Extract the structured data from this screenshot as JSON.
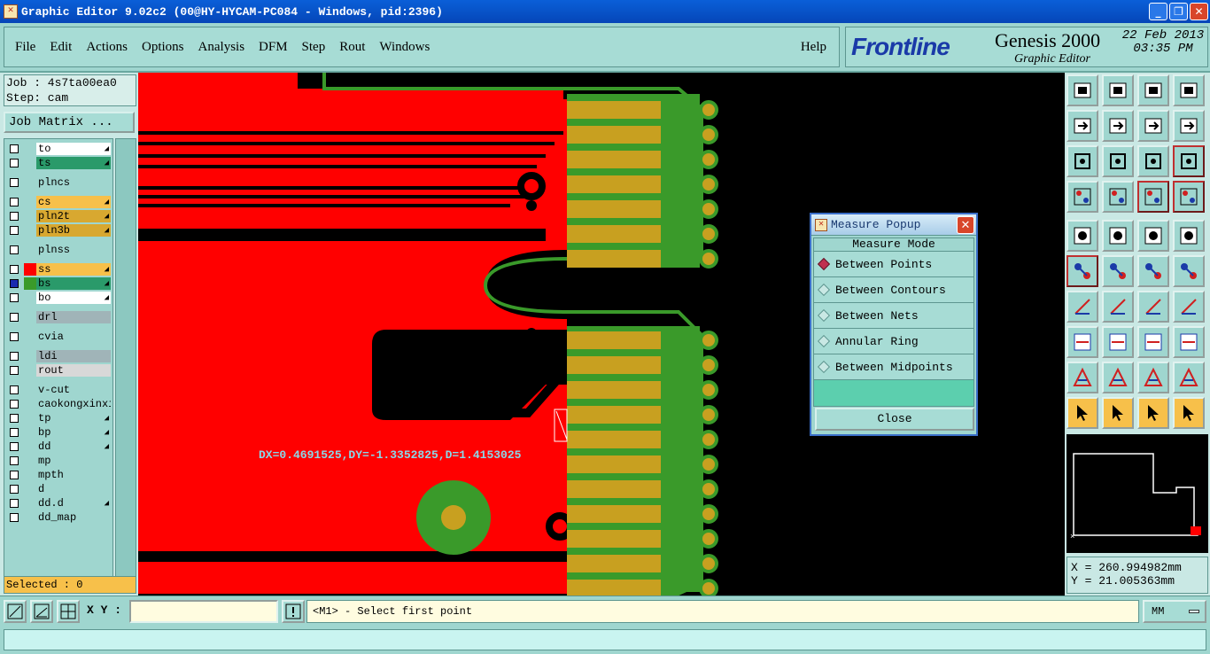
{
  "window": {
    "title": "Graphic Editor 9.02c2 (00@HY-HYCAM-PC084 - Windows, pid:2396)"
  },
  "menu": {
    "items": [
      "File",
      "Edit",
      "Actions",
      "Options",
      "Analysis",
      "DFM",
      "Step",
      "Rout",
      "Windows"
    ],
    "help": "Help"
  },
  "brand": {
    "logo": "Frontline",
    "product": "Genesis 2000",
    "subtitle": "Graphic Editor",
    "date": "22 Feb 2013",
    "time": "03:35 PM"
  },
  "job": {
    "job_line": "Job : 4s7ta00ea0",
    "step_line": "Step: cam",
    "matrix_button": "Job Matrix ..."
  },
  "layers": [
    {
      "name": "to",
      "color": "#ffffff",
      "arrow": true
    },
    {
      "name": "ts",
      "color": "#2a9a6a",
      "arrow": true
    },
    {
      "name": "plncs",
      "color": "#9fd6cf",
      "arrow": false
    },
    {
      "name": "cs",
      "color": "#f7c04a",
      "arrow": true
    },
    {
      "name": "pln2t",
      "color": "#d8a830",
      "arrow": true
    },
    {
      "name": "pln3b",
      "color": "#d8a830",
      "arrow": true
    },
    {
      "name": "plnss",
      "color": "#9fd6cf",
      "arrow": false
    },
    {
      "name": "ss",
      "color": "#f7c04a",
      "arrow": true
    },
    {
      "name": "bs",
      "color": "#2a9a6a",
      "arrow": true
    },
    {
      "name": "bo",
      "color": "#ffffff",
      "arrow": true
    },
    {
      "name": "drl",
      "color": "#a0b4b8",
      "arrow": false
    },
    {
      "name": "cvia",
      "color": "#9fd6cf",
      "arrow": false
    },
    {
      "name": "ldi",
      "color": "#a0b4b8",
      "arrow": false
    },
    {
      "name": "rout",
      "color": "#d8d8d8",
      "arrow": false
    },
    {
      "name": "v-cut",
      "color": "#9fd6cf",
      "arrow": false
    },
    {
      "name": "caokongxinxi",
      "color": "#9fd6cf",
      "arrow": false
    },
    {
      "name": "tp",
      "color": "#9fd6cf",
      "arrow": true
    },
    {
      "name": "bp",
      "color": "#9fd6cf",
      "arrow": true
    },
    {
      "name": "dd",
      "color": "#9fd6cf",
      "arrow": true
    },
    {
      "name": "mp",
      "color": "#9fd6cf",
      "arrow": false
    },
    {
      "name": "mpth",
      "color": "#9fd6cf",
      "arrow": false
    },
    {
      "name": "d",
      "color": "#9fd6cf",
      "arrow": false
    },
    {
      "name": "dd.d",
      "color": "#9fd6cf",
      "arrow": true
    },
    {
      "name": "dd_map",
      "color": "#9fd6cf",
      "arrow": false
    }
  ],
  "selected": "Selected : 0",
  "canvas": {
    "measure_readout": "DX=0.4691525,DY=-1.3352825,D=1.4153025",
    "colors": {
      "copper": "#ff0000",
      "pad": "#c8a020",
      "mask": "#3a9a2a",
      "background": "#000000"
    }
  },
  "measure_popup": {
    "title": "Measure Popup",
    "mode_header": "Measure Mode",
    "options": [
      {
        "label": "Between Points",
        "selected": true
      },
      {
        "label": "Between Contours",
        "selected": false
      },
      {
        "label": "Between Nets",
        "selected": false
      },
      {
        "label": "Annular Ring",
        "selected": false
      },
      {
        "label": "Between Midpoints",
        "selected": false
      }
    ],
    "close_label": "Close"
  },
  "coordinates": {
    "x": "X = 260.994982mm",
    "y": "Y = 21.005363mm"
  },
  "statusbar": {
    "xy_label": "X Y :",
    "xy_value": "",
    "prompt": "<M1> - Select first point",
    "units": "MM"
  }
}
